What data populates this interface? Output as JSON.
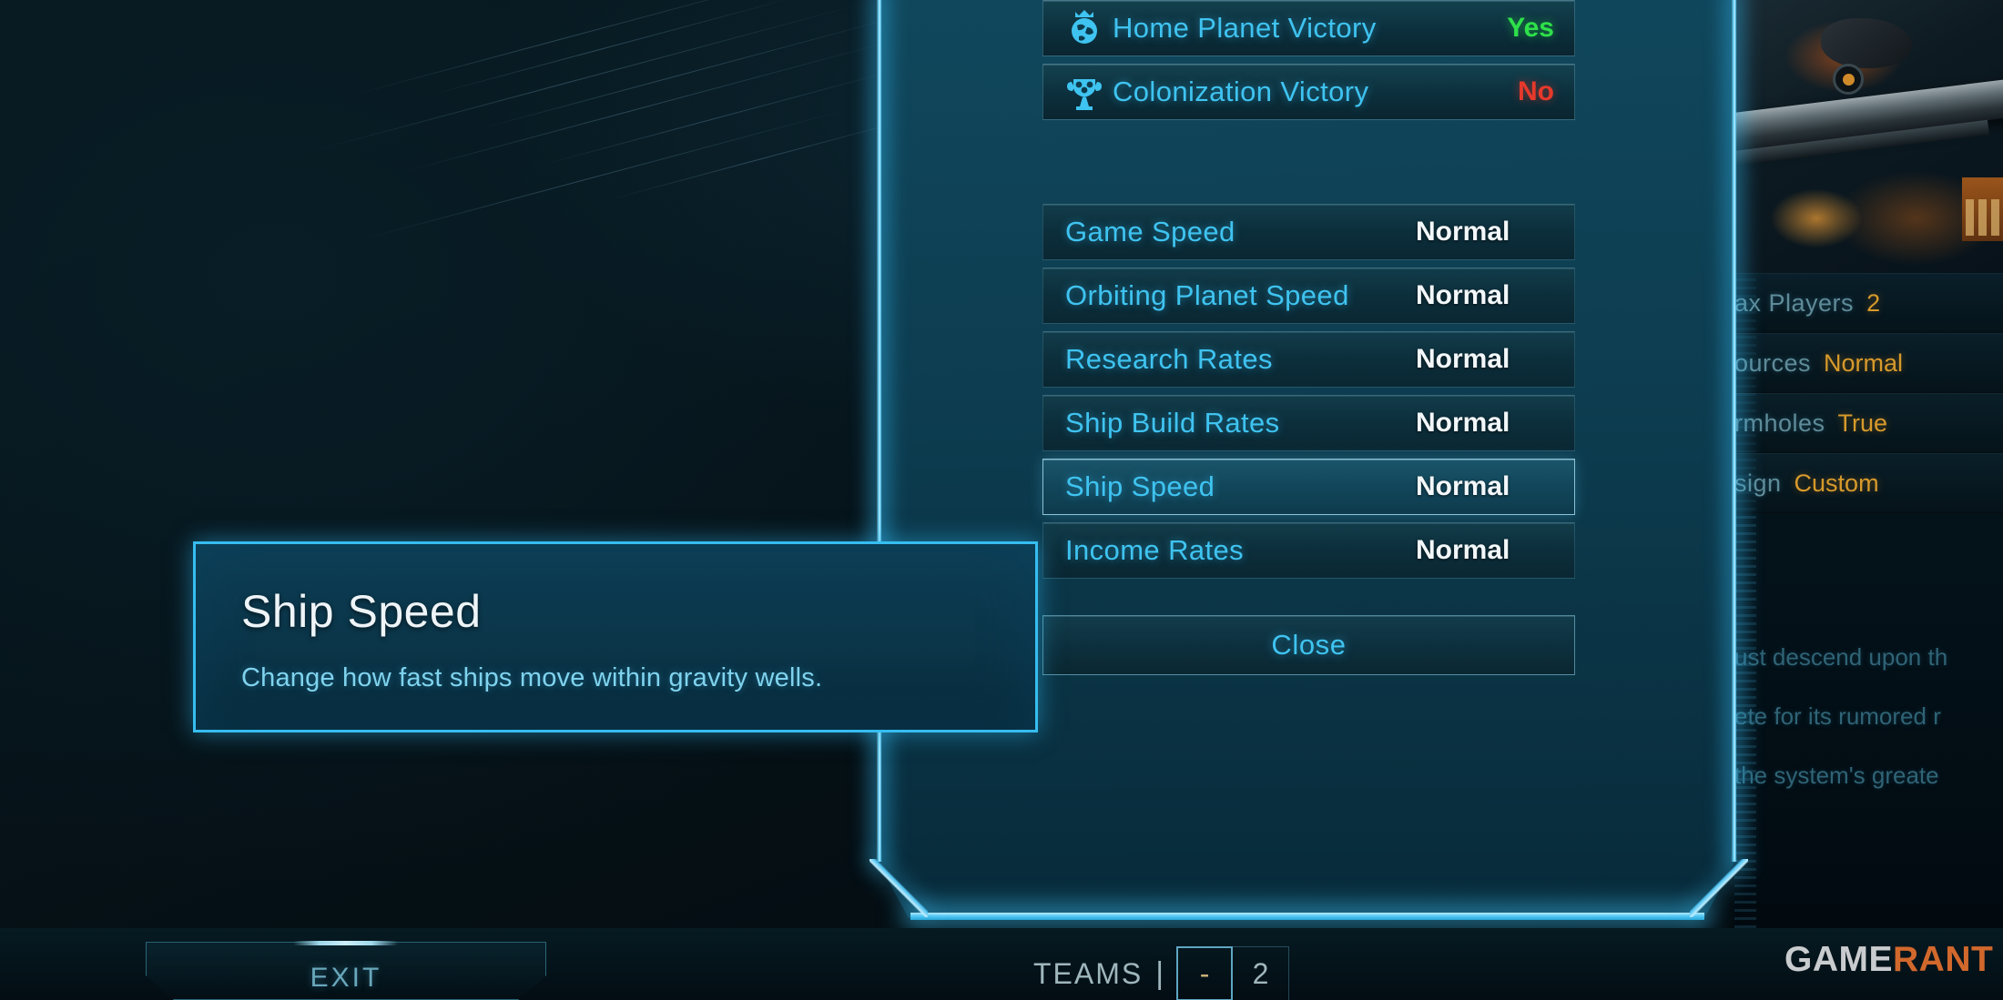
{
  "victory_conditions": [
    {
      "icon": "crowned-planet-icon",
      "label": "Home Planet Victory",
      "value": "Yes",
      "state": "yes"
    },
    {
      "icon": "trophy-icon",
      "label": "Colonization Victory",
      "value": "No",
      "state": "no"
    }
  ],
  "settings": [
    {
      "label": "Game Speed",
      "value": "Normal",
      "selected": false
    },
    {
      "label": "Orbiting Planet Speed",
      "value": "Normal",
      "selected": false
    },
    {
      "label": "Research Rates",
      "value": "Normal",
      "selected": false
    },
    {
      "label": "Ship Build Rates",
      "value": "Normal",
      "selected": false
    },
    {
      "label": "Ship Speed",
      "value": "Normal",
      "selected": true
    },
    {
      "label": "Income Rates",
      "value": "Normal",
      "selected": false
    }
  ],
  "close_button": {
    "label": "Close"
  },
  "tooltip": {
    "title": "Ship Speed",
    "description": "Change how fast ships move within gravity wells."
  },
  "right_panel": {
    "rows": [
      {
        "key": "ax Players",
        "value": "2"
      },
      {
        "key": "ources",
        "value": "Normal"
      },
      {
        "key": "rmholes",
        "value": "True"
      },
      {
        "key": "sign",
        "value": "Custom"
      }
    ],
    "description_lines": [
      "ust descend upon th",
      "ete for its rumored r",
      "the system's greate"
    ]
  },
  "bottom_bar": {
    "exit_label": "EXIT",
    "teams_label": "TEAMS",
    "teams_separator": "|",
    "teams_decrement": "-",
    "teams_value": "2"
  },
  "watermark": {
    "part1": "GAME",
    "part2": "RANT"
  },
  "colors": {
    "accent_cyan": "#3fc3f0",
    "glow_cyan": "#6fd8ff",
    "yes_green": "#2ee04a",
    "no_red": "#e6392c",
    "value_white": "#f2f7fa",
    "gold": "#d79a2b",
    "watermark_orange": "#d1682c"
  }
}
